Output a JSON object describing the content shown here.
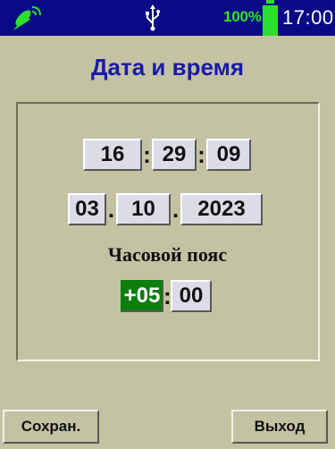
{
  "status": {
    "signal_icon": "satellite-dish-icon",
    "usb_icon": "usb-icon",
    "battery_percent": "100%",
    "battery_level": 1.0,
    "time": "17:00"
  },
  "title": "Дата и время",
  "time": {
    "hours": "16",
    "minutes": "29",
    "seconds": "09",
    "separator": ":"
  },
  "date": {
    "day": "03",
    "month": "10",
    "year": "2023",
    "separator": "."
  },
  "timezone": {
    "label": "Часовой пояс",
    "hours": "+05",
    "minutes": "00",
    "separator": ":"
  },
  "buttons": {
    "save": "Сохран.",
    "exit": "Выход"
  },
  "colors": {
    "background": "#c3c3a4",
    "statusbar": "#0a0a86",
    "title": "#1a1aa8",
    "selected_field": "#0d7d0d",
    "battery": "#2ddf2d"
  }
}
